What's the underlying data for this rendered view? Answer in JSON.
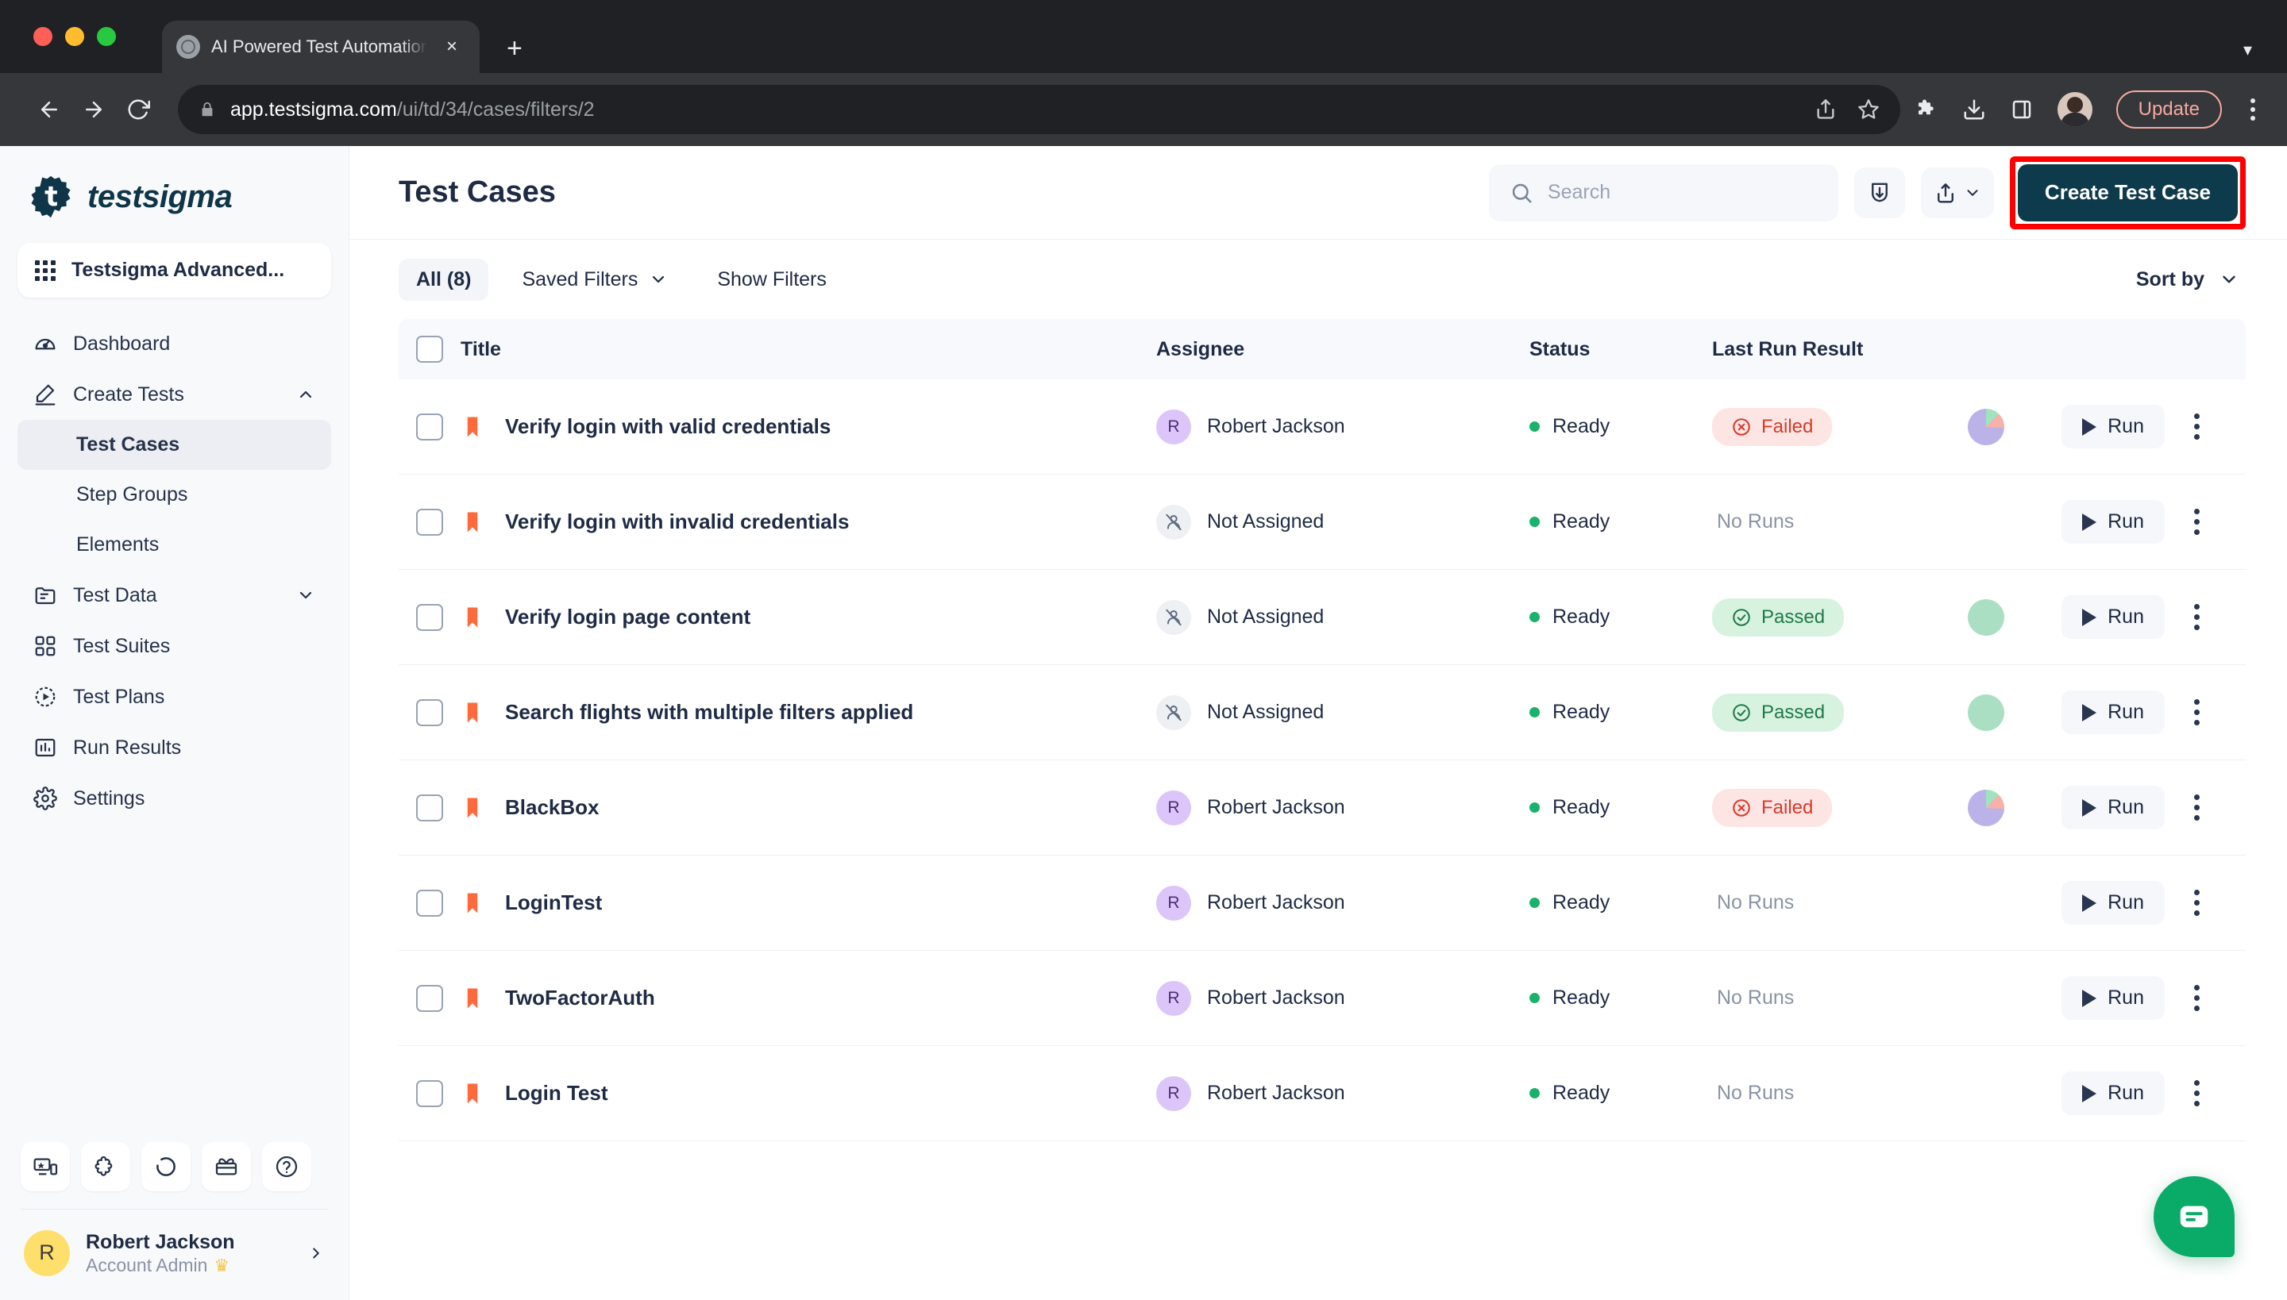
{
  "browser": {
    "tab_title": "AI Powered Test Automation Pla",
    "url_host": "app.testsigma.com",
    "url_path": "/ui/td/34/cases/filters/2",
    "update_label": "Update",
    "new_tab_label": "+",
    "close_tab_label": "×"
  },
  "sidebar": {
    "brand": "testsigma",
    "project": "Testsigma Advanced...",
    "items": [
      {
        "label": "Dashboard",
        "icon": "speedometer-icon",
        "expandable": false,
        "sub": false,
        "active": false
      },
      {
        "label": "Create Tests",
        "icon": "pencil-icon",
        "expandable": true,
        "expanded": true,
        "sub": false,
        "active": false
      },
      {
        "label": "Test Cases",
        "icon": "",
        "expandable": false,
        "sub": true,
        "active": true
      },
      {
        "label": "Step Groups",
        "icon": "",
        "expandable": false,
        "sub": true,
        "active": false
      },
      {
        "label": "Elements",
        "icon": "",
        "expandable": false,
        "sub": true,
        "active": false
      },
      {
        "label": "Test Data",
        "icon": "folder-icon",
        "expandable": true,
        "expanded": false,
        "sub": false,
        "active": false
      },
      {
        "label": "Test Suites",
        "icon": "grid-icon",
        "expandable": false,
        "sub": false,
        "active": false
      },
      {
        "label": "Test Plans",
        "icon": "play-circle-icon",
        "expandable": false,
        "sub": false,
        "active": false
      },
      {
        "label": "Run Results",
        "icon": "bar-chart-icon",
        "expandable": false,
        "sub": false,
        "active": false
      },
      {
        "label": "Settings",
        "icon": "gear-icon",
        "expandable": false,
        "sub": false,
        "active": false
      }
    ],
    "tools": [
      "devices-icon",
      "puzzle-icon",
      "circle-dashed-icon",
      "gift-icon",
      "help-icon"
    ],
    "user": {
      "initial": "R",
      "name": "Robert Jackson",
      "role": "Account Admin",
      "crown": "♛"
    }
  },
  "header": {
    "title": "Test Cases",
    "search_placeholder": "Search",
    "search_value": "",
    "import_icon": "import-icon",
    "export_icon": "export-icon",
    "cta_label": "Create Test Case"
  },
  "filters": {
    "all_label": "All (8)",
    "saved_filters_label": "Saved Filters",
    "show_filters_label": "Show Filters",
    "sort_by_label": "Sort by"
  },
  "table": {
    "columns": [
      "Title",
      "Assignee",
      "Status",
      "Last Run Result"
    ],
    "rows": [
      {
        "title": "Verify login with valid credentials",
        "assignee": "Robert Jackson",
        "assigned": true,
        "initial": "R",
        "status": "Ready",
        "result": "Failed",
        "result_type": "failed",
        "chart": "mixed",
        "run_label": "Run"
      },
      {
        "title": "Verify login with invalid credentials",
        "assignee": "Not Assigned",
        "assigned": false,
        "initial": "",
        "status": "Ready",
        "result": "No Runs",
        "result_type": "none",
        "chart": "",
        "run_label": "Run"
      },
      {
        "title": "Verify login page content",
        "assignee": "Not Assigned",
        "assigned": false,
        "initial": "",
        "status": "Ready",
        "result": "Passed",
        "result_type": "passed",
        "chart": "green",
        "run_label": "Run"
      },
      {
        "title": "Search flights with multiple filters applied",
        "assignee": "Not Assigned",
        "assigned": false,
        "initial": "",
        "status": "Ready",
        "result": "Passed",
        "result_type": "passed",
        "chart": "green",
        "run_label": "Run"
      },
      {
        "title": "BlackBox",
        "assignee": "Robert Jackson",
        "assigned": true,
        "initial": "R",
        "status": "Ready",
        "result": "Failed",
        "result_type": "failed",
        "chart": "mixed",
        "run_label": "Run"
      },
      {
        "title": "LoginTest",
        "assignee": "Robert Jackson",
        "assigned": true,
        "initial": "R",
        "status": "Ready",
        "result": "No Runs",
        "result_type": "none",
        "chart": "",
        "run_label": "Run"
      },
      {
        "title": "TwoFactorAuth",
        "assignee": "Robert Jackson",
        "assigned": true,
        "initial": "R",
        "status": "Ready",
        "result": "No Runs",
        "result_type": "none",
        "chart": "",
        "run_label": "Run"
      },
      {
        "title": "Login Test",
        "assignee": "Robert Jackson",
        "assigned": true,
        "initial": "R",
        "status": "Ready",
        "result": "No Runs",
        "result_type": "none",
        "chart": "",
        "run_label": "Run"
      }
    ]
  },
  "chat": {
    "icon": "chat-bubble-icon"
  },
  "colors": {
    "brand_dark": "#0d3b4c",
    "accent_orange": "#ff6a3d",
    "status_green": "#19b26b",
    "failed_text": "#d83a2b",
    "failed_bg": "#fde5e3",
    "passed_text": "#1f7a4a",
    "passed_bg": "#d8f2e0",
    "highlight_red": "#ff0000",
    "chat_green": "#0aab68",
    "avatar_purple": "#dcc6f9",
    "avatar_yellow": "#ffdf6c"
  }
}
